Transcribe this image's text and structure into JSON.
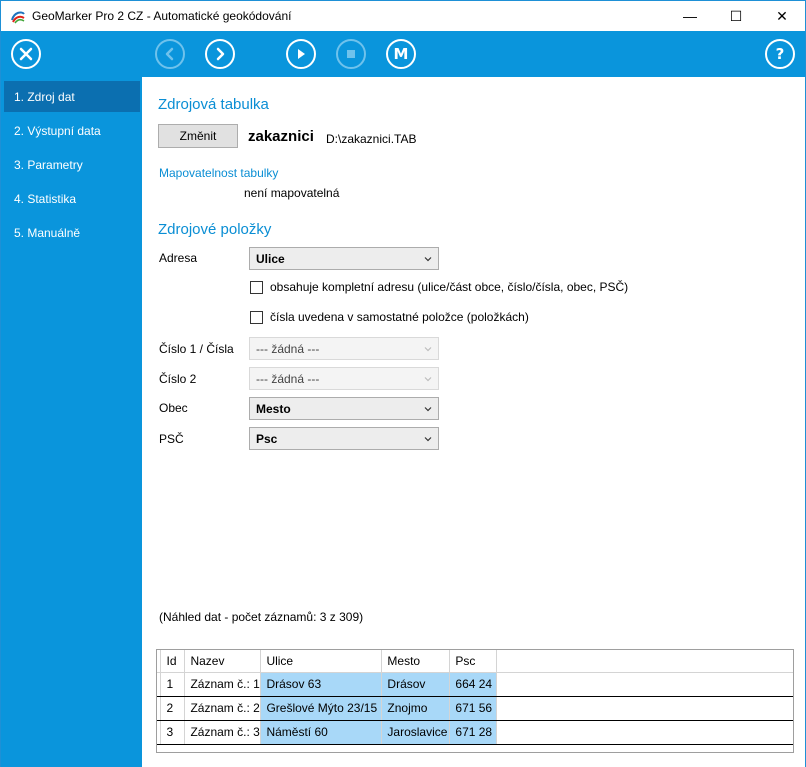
{
  "window": {
    "title": "GeoMarker Pro 2 CZ - Automatické geokódování",
    "controls": {
      "minimize": "—",
      "maximize": "☐",
      "close": "✕"
    }
  },
  "toolbar": {
    "buttons": [
      {
        "name": "close-circle-icon",
        "state": "enabled"
      },
      {
        "name": "back-icon",
        "state": "disabled"
      },
      {
        "name": "forward-icon",
        "state": "enabled"
      },
      {
        "name": "play-icon",
        "state": "enabled"
      },
      {
        "name": "stop-icon",
        "state": "disabled"
      },
      {
        "name": "m-icon",
        "label": "M",
        "state": "enabled"
      },
      {
        "name": "help-icon",
        "label": "?",
        "state": "enabled"
      }
    ]
  },
  "sidebar": {
    "items": [
      {
        "label": "1. Zdroj dat",
        "active": true
      },
      {
        "label": "2. Výstupní data",
        "active": false
      },
      {
        "label": "3. Parametry",
        "active": false
      },
      {
        "label": "4. Statistika",
        "active": false
      },
      {
        "label": "5. Manuálně",
        "active": false
      }
    ]
  },
  "source_table": {
    "heading": "Zdrojová tabulka",
    "change_button": "Změnit",
    "table_name": "zakaznici",
    "table_path": "D:\\zakaznici.TAB",
    "mappability_heading": "Mapovatelnost tabulky",
    "mappability_value": "není mapovatelná"
  },
  "source_fields": {
    "heading": "Zdrojové položky",
    "address_label": "Adresa",
    "address_value": "Ulice",
    "chk_full_address": "obsahuje kompletní adresu (ulice/část obce, číslo/čísla, obec, PSČ)",
    "chk_numbers_separate": "čísla uvedena v samostatné položce (položkách)",
    "number1_label": "Číslo 1 / Čísla",
    "number1_value": "--- žádná ---",
    "number2_label": "Číslo 2",
    "number2_value": "--- žádná ---",
    "city_label": "Obec",
    "city_value": "Mesto",
    "zip_label": "PSČ",
    "zip_value": "Psc"
  },
  "preview": {
    "caption": "(Náhled dat - počet záznamů: 3 z 309)",
    "columns": [
      "Id",
      "Nazev",
      "Ulice",
      "Mesto",
      "Psc"
    ],
    "rows": [
      [
        "1",
        "Záznam č.: 1",
        "Drásov 63",
        "Drásov",
        "664 24"
      ],
      [
        "2",
        "Záznam č.: 2",
        "Grešlové Mýto 23/15",
        "Znojmo",
        "671 56"
      ],
      [
        "3",
        "Záznam č.: 3",
        "Náměstí 60",
        "Jaroslavice",
        "671 28"
      ]
    ]
  },
  "colors": {
    "accent": "#0a95dc",
    "sidebar_active": "#0b6fb0",
    "heading": "#0a8ed4",
    "cell_selected": "#a8d8f8"
  }
}
